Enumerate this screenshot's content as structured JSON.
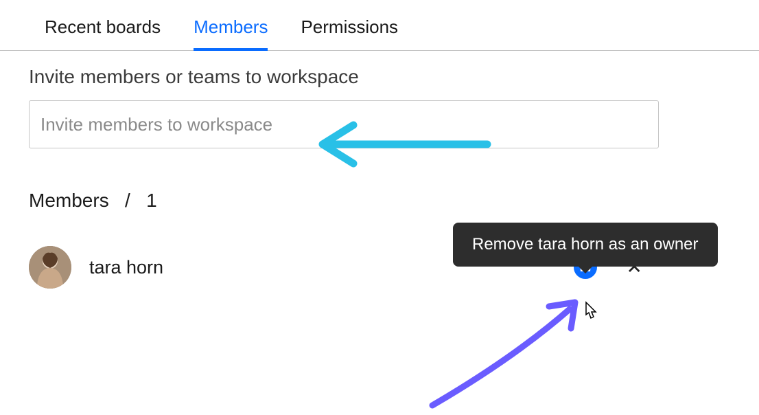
{
  "tabs": [
    {
      "label": "Recent boards",
      "active": false
    },
    {
      "label": "Members",
      "active": true
    },
    {
      "label": "Permissions",
      "active": false
    }
  ],
  "invite": {
    "label": "Invite members or teams to workspace",
    "placeholder": "Invite members to workspace"
  },
  "members": {
    "header_prefix": "Members",
    "separator": "/",
    "count": "1",
    "list": [
      {
        "name": "tara horn"
      }
    ]
  },
  "tooltip": {
    "text": "Remove tara horn as an owner"
  },
  "icons": {
    "crown": "crown-icon",
    "close": "✕"
  }
}
